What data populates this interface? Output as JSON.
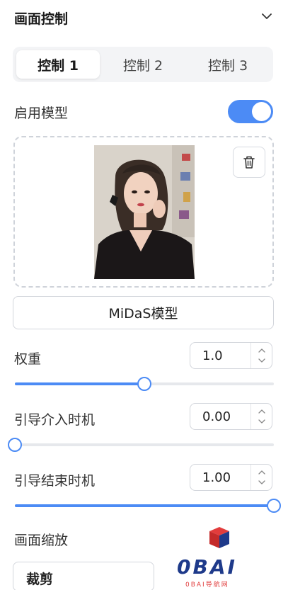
{
  "header": {
    "title": "画面控制"
  },
  "tabs": [
    {
      "label": "控制 1",
      "active": true
    },
    {
      "label": "控制 2",
      "active": false
    },
    {
      "label": "控制 3",
      "active": false
    }
  ],
  "enable_model": {
    "label": "启用模型",
    "on": true
  },
  "model_button": {
    "label": "MiDaS模型"
  },
  "weight": {
    "label": "权重",
    "value": "1.0",
    "slider_fraction": 0.5
  },
  "guidance_start": {
    "label": "引导介入时机",
    "value": "0.00",
    "slider_fraction": 0.0
  },
  "guidance_end": {
    "label": "引导结束时机",
    "value": "1.00",
    "slider_fraction": 1.0
  },
  "resize": {
    "label": "画面缩放",
    "selected": "裁剪"
  },
  "watermark": {
    "logo_text": "0BAI",
    "sub_text": "0BAI导航网"
  },
  "colors": {
    "accent": "#4c8bf5",
    "track": "#e6e8ec",
    "border": "#d3d6dc"
  },
  "icons": {
    "collapse": "chevron-down-icon",
    "delete": "trash-icon",
    "increment": "chevron-up-icon",
    "decrement": "chevron-down-icon"
  }
}
